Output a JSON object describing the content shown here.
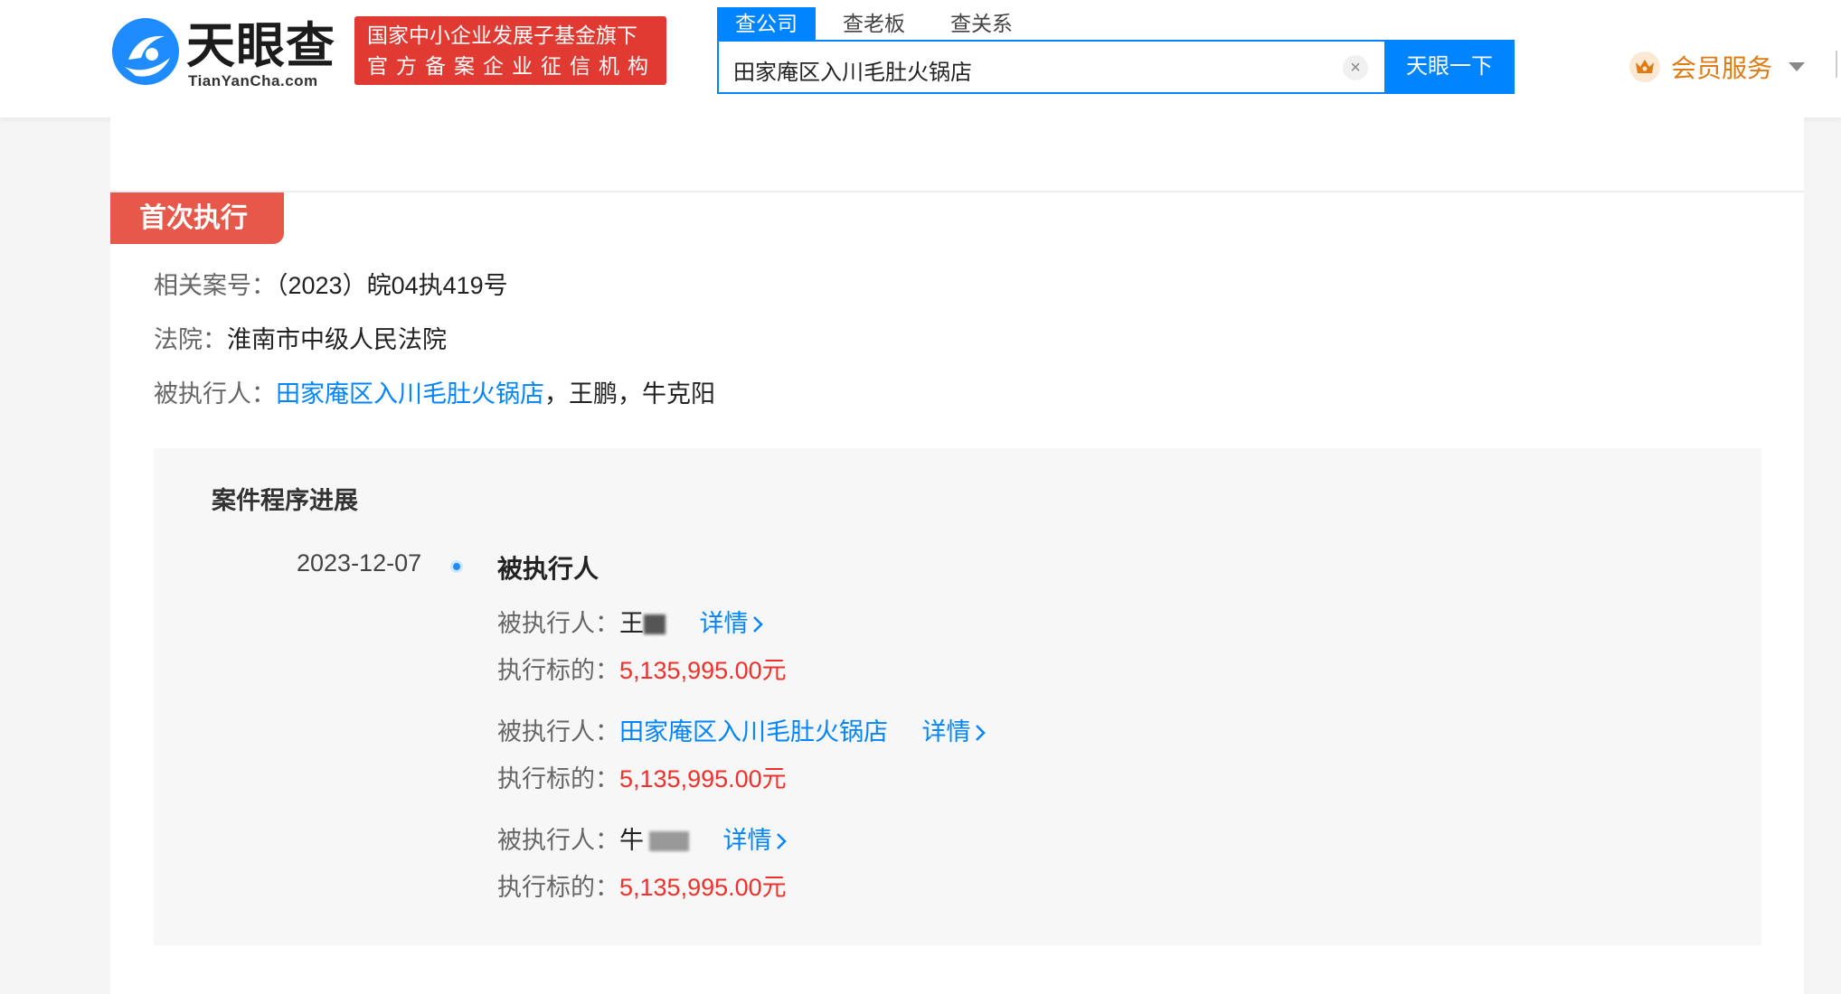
{
  "header": {
    "logo_cn": "天眼查",
    "logo_en": "TianYanCha.com",
    "slogan_line1": "国家中小企业发展子基金旗下",
    "slogan_line2": "官方备案企业征信机构",
    "search_tabs": [
      "查公司",
      "查老板",
      "查关系"
    ],
    "search_value": "田家庵区入川毛肚火锅店",
    "search_clear": "×",
    "search_button": "天眼一下",
    "vip_label": "会员服务",
    "brand_color": "#0084ff",
    "icons": [
      "logo-icon",
      "close-icon",
      "crown-icon",
      "caret-down-icon",
      "chevron-right-icon"
    ]
  },
  "section": {
    "tag": "首次执行",
    "case_no_label": "相关案号：",
    "case_no": "（2023）皖04执419号",
    "court_label": "法院：",
    "court": "淮南市中级人民法院",
    "executed_label": "被执行人：",
    "executed_link": "田家庵区入川毛肚火锅店",
    "executed_rest": "，王鹏，牛克阳",
    "accent_color": "#e5584a"
  },
  "progress": {
    "title": "案件程序进展",
    "date": "2023-12-07",
    "event": "被执行人",
    "entries": [
      {
        "label": "被执行人：",
        "name": "王",
        "amount_label": "执行标的：",
        "amount": "5,135,995.00元",
        "detail": "详情"
      },
      {
        "label": "被执行人：",
        "name": "田家庵区入川毛肚火锅店",
        "amount_label": "执行标的：",
        "amount": "5,135,995.00元",
        "detail": "详情"
      },
      {
        "label": "被执行人：",
        "name": "牛",
        "amount_label": "执行标的：",
        "amount": "5,135,995.00元",
        "detail": "详情"
      }
    ]
  }
}
